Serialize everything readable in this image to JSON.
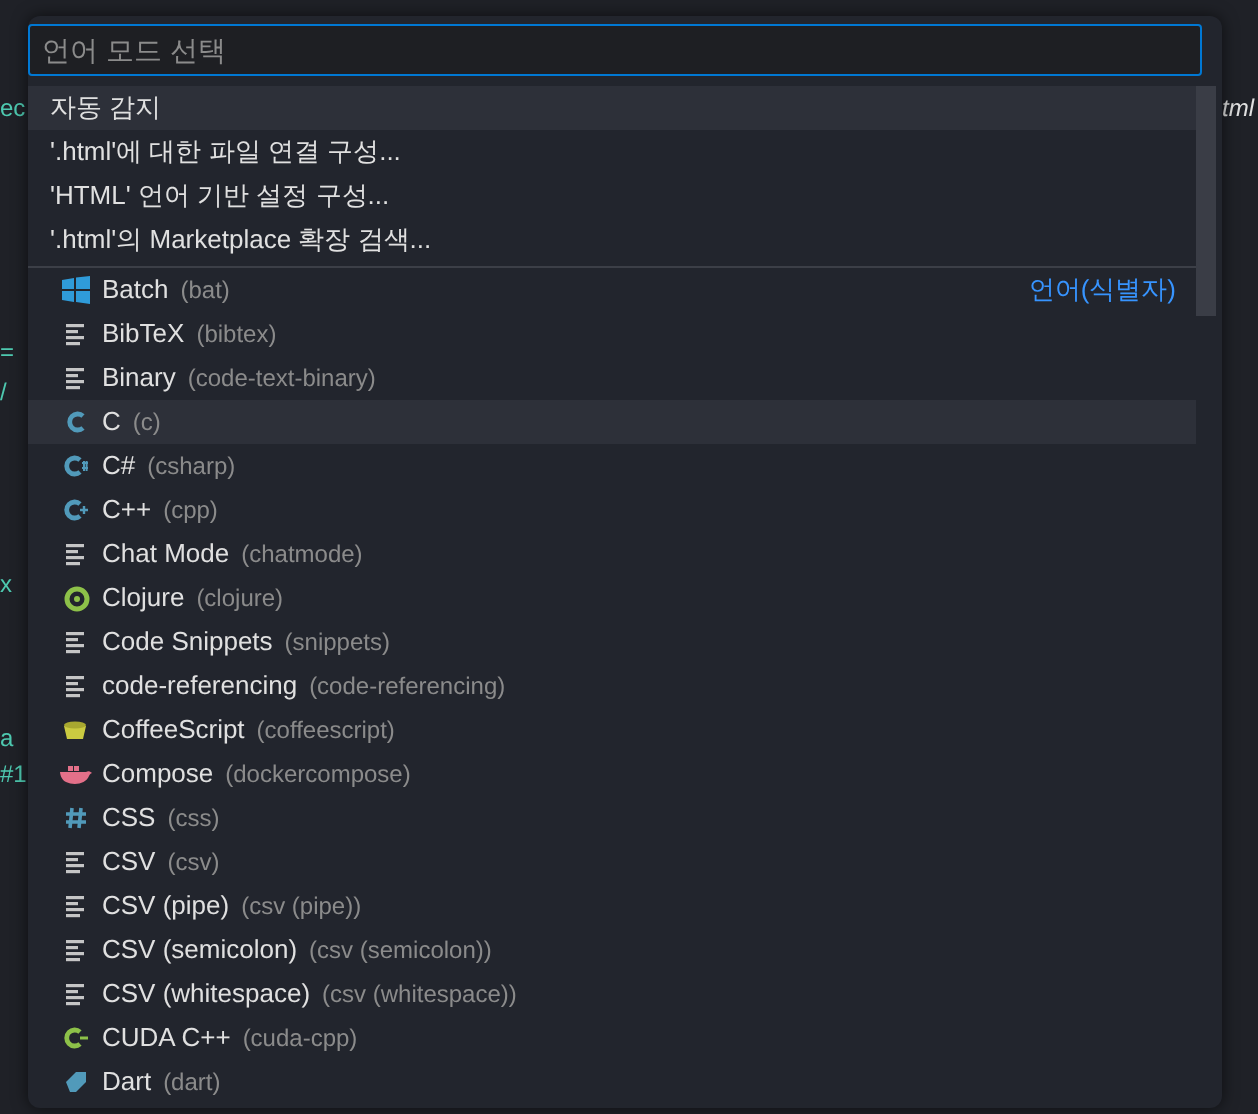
{
  "background_editor": {
    "fragments": [
      {
        "text": "ec",
        "kind": "gutter"
      },
      {
        "text": "=",
        "kind": "gutter"
      },
      {
        "text": "/",
        "kind": "gutter"
      },
      {
        "text": "x",
        "kind": "gutter"
      },
      {
        "text": "a",
        "kind": "gutter"
      },
      {
        "text": "#1",
        "kind": "gutter"
      },
      {
        "text": "tml",
        "kind": "tab"
      }
    ]
  },
  "quick_pick": {
    "input": {
      "placeholder": "언어 모드 선택"
    },
    "actions": [
      {
        "label": "자동 감지",
        "highlighted": true
      },
      {
        "label": "'.html'에 대한 파일 연결 구성...",
        "highlighted": false
      },
      {
        "label": "'HTML' 언어 기반 설정 구성...",
        "highlighted": false
      },
      {
        "label": "'.html'의 Marketplace 확장 검색...",
        "highlighted": false
      }
    ],
    "group_label": "언어(식별자)",
    "languages": [
      {
        "kind": "windows",
        "label": "Batch",
        "id": "(bat)",
        "highlighted": false
      },
      {
        "kind": "lines",
        "label": "BibTeX",
        "id": "(bibtex)",
        "highlighted": false
      },
      {
        "kind": "lines",
        "label": "Binary",
        "id": "(code-text-binary)",
        "highlighted": false
      },
      {
        "kind": "c",
        "label": "C",
        "id": "(c)",
        "highlighted": true
      },
      {
        "kind": "csharp",
        "label": "C#",
        "id": "(csharp)",
        "highlighted": false
      },
      {
        "kind": "cpp",
        "label": "C++",
        "id": "(cpp)",
        "highlighted": false
      },
      {
        "kind": "lines",
        "label": "Chat Mode",
        "id": "(chatmode)",
        "highlighted": false
      },
      {
        "kind": "clojure",
        "label": "Clojure",
        "id": "(clojure)",
        "highlighted": false
      },
      {
        "kind": "lines",
        "label": "Code Snippets",
        "id": "(snippets)",
        "highlighted": false
      },
      {
        "kind": "lines",
        "label": "code-referencing",
        "id": "(code-referencing)",
        "highlighted": false
      },
      {
        "kind": "coffee",
        "label": "CoffeeScript",
        "id": "(coffeescript)",
        "highlighted": false
      },
      {
        "kind": "docker",
        "label": "Compose",
        "id": "(dockercompose)",
        "highlighted": false
      },
      {
        "kind": "hash",
        "label": "CSS",
        "id": "(css)",
        "highlighted": false
      },
      {
        "kind": "lines",
        "label": "CSV",
        "id": "(csv)",
        "highlighted": false
      },
      {
        "kind": "lines",
        "label": "CSV (pipe)",
        "id": "(csv (pipe))",
        "highlighted": false
      },
      {
        "kind": "lines",
        "label": "CSV (semicolon)",
        "id": "(csv (semicolon))",
        "highlighted": false
      },
      {
        "kind": "lines",
        "label": "CSV (whitespace)",
        "id": "(csv (whitespace))",
        "highlighted": false
      },
      {
        "kind": "cuda",
        "label": "CUDA C++",
        "id": "(cuda-cpp)",
        "highlighted": false
      },
      {
        "kind": "dart",
        "label": "Dart",
        "id": "(dart)",
        "highlighted": false
      }
    ]
  }
}
